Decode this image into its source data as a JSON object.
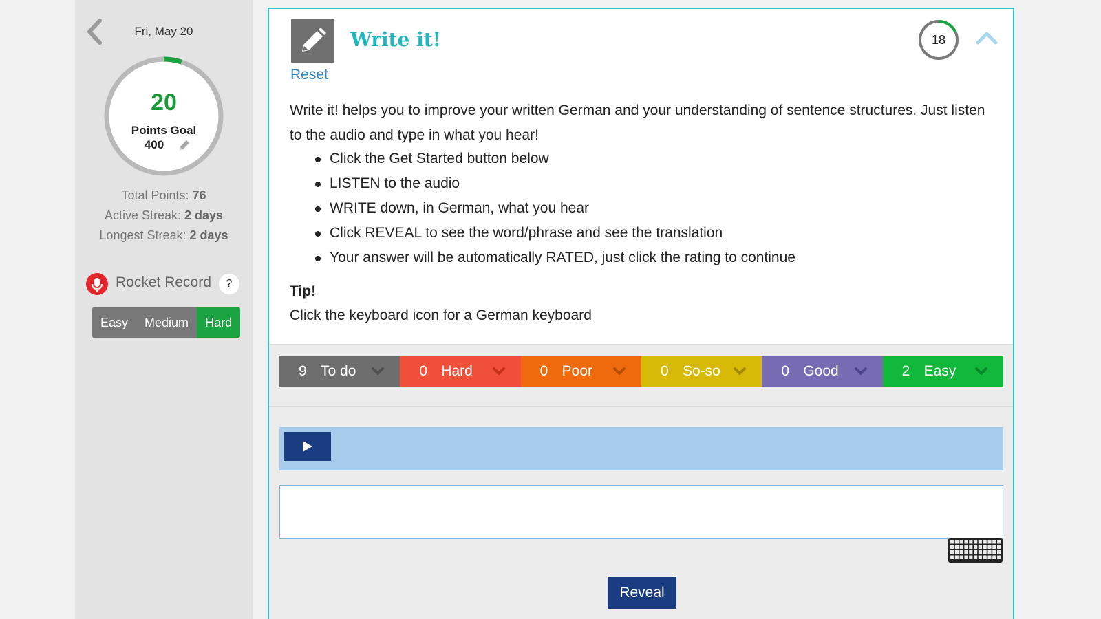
{
  "sidebar": {
    "date": "Fri, May 20",
    "goal": {
      "points": "20",
      "label": "Points Goal",
      "value": "400",
      "progress": 0.05
    },
    "stats": [
      {
        "label": "Total Points: ",
        "value": "76"
      },
      {
        "label": "Active Streak: ",
        "value": "2 days"
      },
      {
        "label": "Longest Streak: ",
        "value": "2 days"
      }
    ],
    "rocket_record": {
      "label": "Rocket Record",
      "help": "?"
    },
    "difficulty": {
      "options": [
        "Easy",
        "Medium",
        "Hard"
      ],
      "selected": "Hard"
    }
  },
  "card": {
    "title": "Write it!",
    "reset": "Reset",
    "counter": "18",
    "counter_progress": 0.18,
    "description": "Write it! helps you to improve your written German and your understanding of sentence structures. Just listen to the audio and type in what you hear!",
    "bullets": [
      "Click the Get Started button below",
      "LISTEN to the audio",
      "WRITE down, in German, what you hear",
      "Click REVEAL to see the word/phrase and see the translation",
      "Your answer will be automatically RATED, just click the rating to continue"
    ],
    "tip_title": "Tip!",
    "tip_text": "Click the keyboard icon for a German keyboard"
  },
  "ratings": [
    {
      "count": "9",
      "label": "To do",
      "color": "#6e6e6e",
      "chev": "#4f4f4f"
    },
    {
      "count": "0",
      "label": "Hard",
      "color": "#f0503a",
      "chev": "#c6311c"
    },
    {
      "count": "0",
      "label": "Poor",
      "color": "#ef6a0c",
      "chev": "#b84c00"
    },
    {
      "count": "0",
      "label": "So-so",
      "color": "#d7b908",
      "chev": "#a08900"
    },
    {
      "count": "0",
      "label": "Good",
      "color": "#776cb3",
      "chev": "#4f4690"
    },
    {
      "count": "2",
      "label": "Easy",
      "color": "#10b93a",
      "chev": "#09862a"
    }
  ],
  "answer": {
    "value": "",
    "placeholder": ""
  },
  "reveal_label": "Reveal",
  "colors": {
    "accent": "#22b7bf",
    "primary": "#1a3c80",
    "success": "#1a9a37",
    "link": "#2a86c5"
  }
}
